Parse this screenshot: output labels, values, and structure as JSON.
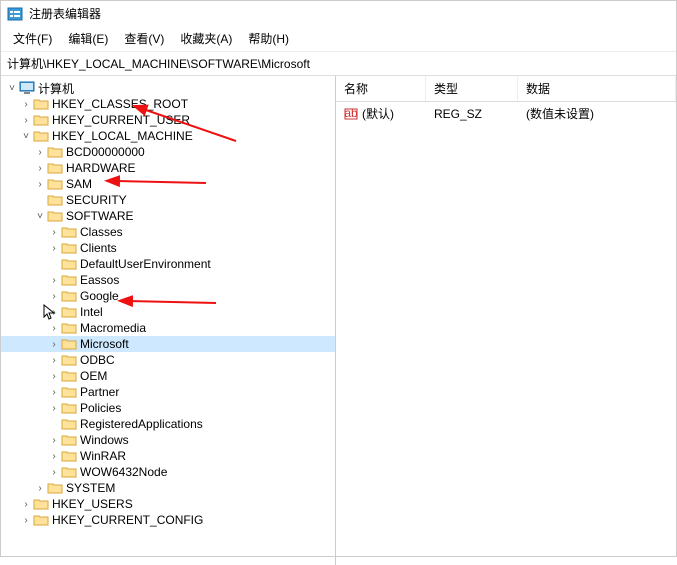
{
  "window": {
    "title": "注册表编辑器"
  },
  "menu": {
    "file": "文件(F)",
    "edit": "编辑(E)",
    "view": "查看(V)",
    "favorites": "收藏夹(A)",
    "help": "帮助(H)"
  },
  "address": "计算机\\HKEY_LOCAL_MACHINE\\SOFTWARE\\Microsoft",
  "tree": {
    "root": {
      "label": "计算机"
    },
    "hkcr": {
      "label": "HKEY_CLASSES_ROOT"
    },
    "hkcu": {
      "label": "HKEY_CURRENT_USER"
    },
    "hklm": {
      "label": "HKEY_LOCAL_MACHINE"
    },
    "bcd": {
      "label": "BCD00000000"
    },
    "hardware": {
      "label": "HARDWARE"
    },
    "sam": {
      "label": "SAM"
    },
    "security": {
      "label": "SECURITY"
    },
    "software": {
      "label": "SOFTWARE"
    },
    "classes": {
      "label": "Classes"
    },
    "clients": {
      "label": "Clients"
    },
    "due": {
      "label": "DefaultUserEnvironment"
    },
    "eassos": {
      "label": "Eassos"
    },
    "google": {
      "label": "Google"
    },
    "intel": {
      "label": "Intel"
    },
    "macromedia": {
      "label": "Macromedia"
    },
    "microsoft": {
      "label": "Microsoft"
    },
    "odbc": {
      "label": "ODBC"
    },
    "oem": {
      "label": "OEM"
    },
    "partner": {
      "label": "Partner"
    },
    "policies": {
      "label": "Policies"
    },
    "regapps": {
      "label": "RegisteredApplications"
    },
    "windows": {
      "label": "Windows"
    },
    "winrar": {
      "label": "WinRAR"
    },
    "wow64": {
      "label": "WOW6432Node"
    },
    "system": {
      "label": "SYSTEM"
    },
    "hku": {
      "label": "HKEY_USERS"
    },
    "hkcc": {
      "label": "HKEY_CURRENT_CONFIG"
    }
  },
  "list": {
    "headers": {
      "name": "名称",
      "type": "类型",
      "data": "数据"
    },
    "rows": [
      {
        "name": "(默认)",
        "type": "REG_SZ",
        "data": "(数值未设置)"
      }
    ]
  }
}
